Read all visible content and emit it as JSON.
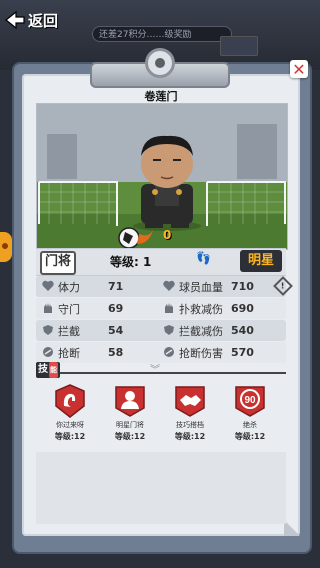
{
  "topbar": {
    "back_label": "返回",
    "progress_text": "还差27积分……级奖励"
  },
  "card": {
    "title": "卷莲门",
    "score": "0",
    "position": "门将",
    "level_label": "等级: 1",
    "star_label": "明星"
  },
  "stats": [
    {
      "left": {
        "label": "体力",
        "value": "71",
        "icon": "heart-icon"
      },
      "right": {
        "label": "球员血量",
        "value": "710",
        "icon": "heart-icon"
      }
    },
    {
      "left": {
        "label": "守门",
        "value": "69",
        "icon": "glove-icon"
      },
      "right": {
        "label": "扑救减伤",
        "value": "690",
        "icon": "glove-icon"
      }
    },
    {
      "left": {
        "label": "拦截",
        "value": "54",
        "icon": "shield-icon"
      },
      "right": {
        "label": "拦截减伤",
        "value": "540",
        "icon": "shield-icon"
      }
    },
    {
      "left": {
        "label": "抢断",
        "value": "58",
        "icon": "tackle-icon"
      },
      "right": {
        "label": "抢断伤害",
        "value": "570",
        "icon": "tackle-icon"
      }
    }
  ],
  "info_icon": "!",
  "skills_header": {
    "label": "技",
    "tag": "能"
  },
  "skills": [
    {
      "name": "你过来呀",
      "level": "等级:12",
      "icon": "beckon-icon"
    },
    {
      "name": "明星门将",
      "level": "等级:12",
      "icon": "star-keeper-icon"
    },
    {
      "name": "技巧搭档",
      "level": "等级:12",
      "icon": "handshake-icon"
    },
    {
      "name": "绝杀",
      "level": "等级:12",
      "icon": "clock-90-icon",
      "badge_text": "90"
    }
  ],
  "colors": {
    "accent": "#ffb520",
    "skill_red": "#c8312f",
    "board": "#6f7e93"
  }
}
